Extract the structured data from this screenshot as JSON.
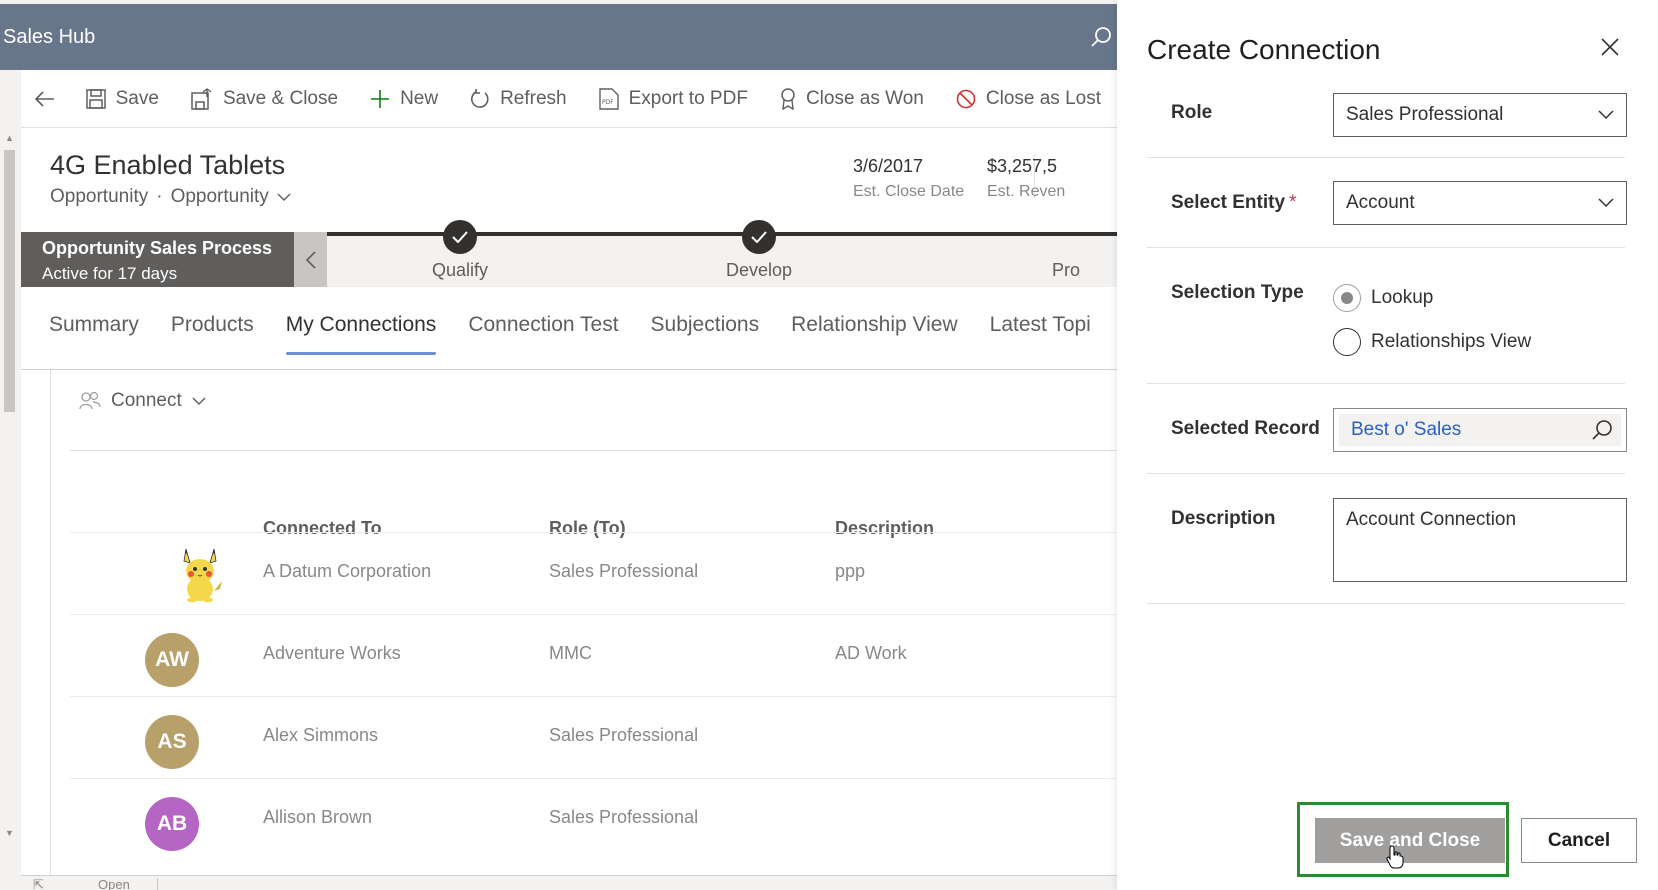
{
  "app": {
    "title": "Sales Hub"
  },
  "commands": [
    {
      "label": "Save",
      "icon": "save-icon"
    },
    {
      "label": "Save & Close",
      "icon": "save-close-icon"
    },
    {
      "label": "New",
      "icon": "plus-icon"
    },
    {
      "label": "Refresh",
      "icon": "refresh-icon"
    },
    {
      "label": "Export to PDF",
      "icon": "pdf-icon"
    },
    {
      "label": "Close as Won",
      "icon": "award-icon"
    },
    {
      "label": "Close as Lost",
      "icon": "blocked-icon"
    }
  ],
  "record": {
    "title": "4G Enabled Tablets",
    "entity": "Opportunity",
    "form": "Opportunity",
    "close_date": "3/6/2017",
    "close_date_label": "Est. Close Date",
    "revenue": "$3,257,5",
    "revenue_label": "Est. Reven"
  },
  "process": {
    "name": "Opportunity Sales Process",
    "duration": "Active for 17 days",
    "stages": [
      "Qualify",
      "Develop",
      "Pro"
    ]
  },
  "tabs": [
    "Summary",
    "Products",
    "My Connections",
    "Connection Test",
    "Subjections",
    "Relationship View",
    "Latest Topi"
  ],
  "active_tab": "My Connections",
  "connections": {
    "connect_label": "Connect",
    "columns": [
      "Connected To",
      "Role (To)",
      "Description"
    ],
    "rows": [
      {
        "initials": "",
        "name": "A Datum Corporation",
        "role": "Sales Professional",
        "description": "ppp",
        "avatar_color": ""
      },
      {
        "initials": "AW",
        "name": "Adventure Works",
        "role": "MMC",
        "description": "AD Work",
        "avatar_color": "#b8a06a"
      },
      {
        "initials": "AS",
        "name": "Alex Simmons",
        "role": "Sales Professional",
        "description": "",
        "avatar_color": "#b8a06a"
      },
      {
        "initials": "AB",
        "name": "Allison Brown",
        "role": "Sales Professional",
        "description": "",
        "avatar_color": "#b565c4"
      }
    ]
  },
  "footer": {
    "open_label": "Open"
  },
  "panel": {
    "title": "Create Connection",
    "role_label": "Role",
    "role_value": "Sales Professional",
    "entity_label": "Select Entity",
    "entity_required": "*",
    "entity_value": "Account",
    "selection_type_label": "Selection Type",
    "selection_options": [
      "Lookup",
      "Relationships View"
    ],
    "selection_selected": "Lookup",
    "record_label": "Selected Record",
    "record_value": "Best o' Sales",
    "description_label": "Description",
    "description_value": "Account Connection",
    "save_label": "Save and Close",
    "cancel_label": "Cancel"
  }
}
